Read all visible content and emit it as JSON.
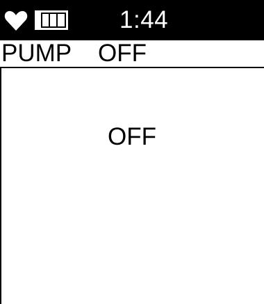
{
  "status_bar": {
    "heart_icon": "heart-icon",
    "battery_icon": "battery-icon",
    "time": "1:44"
  },
  "header": {
    "title": "PUMP",
    "status": "OFF"
  },
  "main": {
    "pump_state": "OFF"
  },
  "colors": {
    "background": "#ffffff",
    "foreground": "#000000",
    "status_bar_background": "#000000",
    "status_bar_foreground": "#ffffff"
  }
}
